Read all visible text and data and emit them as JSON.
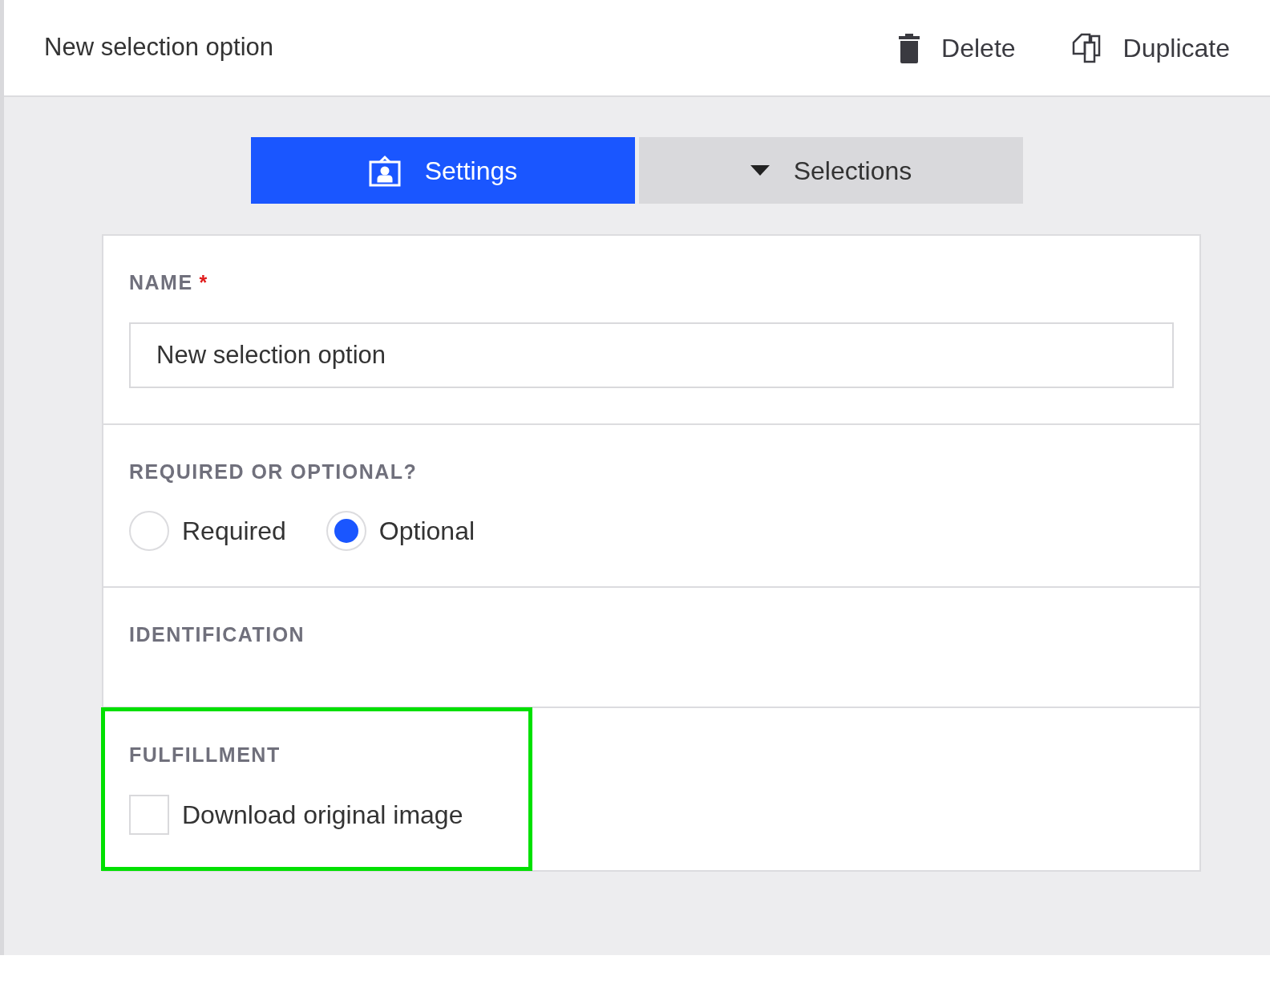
{
  "header": {
    "title": "New selection option",
    "actions": [
      {
        "kind": "delete",
        "label": "Delete"
      },
      {
        "kind": "duplicate",
        "label": "Duplicate"
      }
    ]
  },
  "tabs": [
    {
      "kind": "settings",
      "label": "Settings",
      "selected": true
    },
    {
      "kind": "selections",
      "label": "Selections",
      "selected": false
    }
  ],
  "sections": [
    {
      "kind": "text_field",
      "label": "NAME",
      "required_mark": "*",
      "value": "New selection option",
      "highlighted": false
    },
    {
      "kind": "radio_group",
      "label": "REQUIRED OR OPTIONAL?",
      "options": [
        {
          "label": "Required",
          "selected": false
        },
        {
          "label": "Optional",
          "selected": true
        }
      ],
      "highlighted": false
    },
    {
      "kind": "empty",
      "label": "IDENTIFICATION",
      "highlighted": false
    },
    {
      "kind": "checkbox",
      "label": "FULFILLMENT",
      "option": {
        "label": "Download original image",
        "checked": false
      },
      "highlighted": true
    }
  ]
}
